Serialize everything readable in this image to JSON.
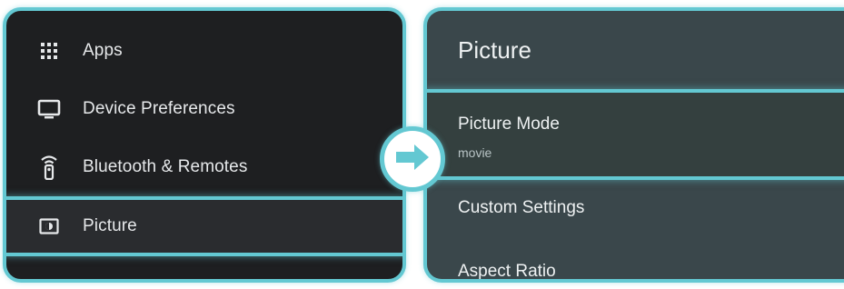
{
  "colors": {
    "accent": "#63c8d2",
    "left_bg": "#1e1f21",
    "right_bg": "#3a474b"
  },
  "left_menu": {
    "items": [
      {
        "label": "Apps",
        "icon": "apps-grid-icon"
      },
      {
        "label": "Device Preferences",
        "icon": "monitor-icon"
      },
      {
        "label": "Bluetooth & Remotes",
        "icon": "remote-icon"
      },
      {
        "label": "Picture",
        "icon": "picture-icon",
        "selected": true
      }
    ]
  },
  "right_panel": {
    "title": "Picture",
    "items": [
      {
        "label": "Picture Mode",
        "value": "movie",
        "selected": true
      },
      {
        "label": "Custom Settings"
      },
      {
        "label": "Aspect Ratio"
      }
    ]
  },
  "arrow_icon": "arrow-right-icon"
}
